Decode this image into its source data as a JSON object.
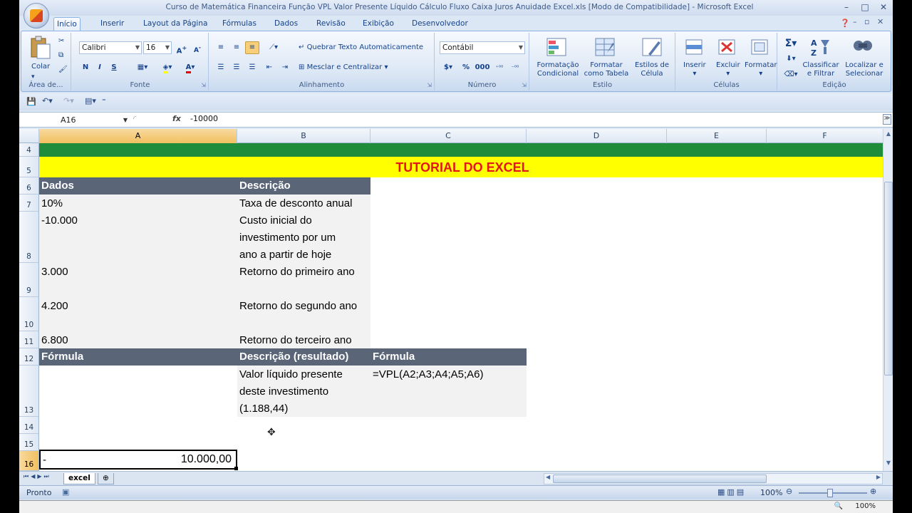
{
  "window": {
    "title": "Curso de Matemática Financeira Função VPL Valor Presente Líquido Cálculo Fluxo Caixa Juros Anuidade Excel.xls  [Modo de Compatibilidade] - Microsoft Excel"
  },
  "tabs": [
    "Início",
    "Inserir",
    "Layout da Página",
    "Fórmulas",
    "Dados",
    "Revisão",
    "Exibição",
    "Desenvolvedor"
  ],
  "ribbon": {
    "clipboard": {
      "paste": "Colar",
      "label": "Área de..."
    },
    "font": {
      "name": "Calibri",
      "size": "16",
      "bold": "N",
      "italic": "I",
      "underline": "S",
      "label": "Fonte"
    },
    "alignment": {
      "wrap": "Quebrar Texto Automaticamente",
      "merge": "Mesclar e Centralizar",
      "label": "Alinhamento"
    },
    "number": {
      "format": "Contábil",
      "currency": "$",
      "percent": "%",
      "thousands": "000",
      "label": "Número"
    },
    "styles": {
      "conditional": "Formatação Condicional",
      "as_table": "Formatar como Tabela",
      "cell_styles": "Estilos de Célula",
      "label": "Estilo"
    },
    "cells": {
      "insert": "Inserir",
      "delete": "Excluir",
      "format": "Formatar",
      "label": "Células"
    },
    "editing": {
      "sigma": "Σ",
      "sort": "Classificar e Filtrar",
      "find": "Localizar e Selecionar",
      "label": "Edição"
    }
  },
  "formula_bar": {
    "cell": "A16",
    "fx": "fx",
    "value": "-10000"
  },
  "columns": [
    "A",
    "B",
    "C",
    "D",
    "E",
    "F"
  ],
  "rows": [
    "4",
    "5",
    "6",
    "7",
    "8",
    "9",
    "10",
    "11",
    "12",
    "13",
    "14",
    "15",
    "16"
  ],
  "cells": {
    "title": "TUTORIAL DO EXCEL",
    "dados": "Dados",
    "descricao": "Descrição",
    "a7": "10%",
    "b7": "Taxa de desconto anual",
    "a8": "-10.000",
    "b8_1": "Custo inicial do",
    "b8_2": "investimento por um",
    "b8_3": "ano a partir de hoje",
    "a9": "3.000",
    "b9": "Retorno do primeiro ano",
    "a10": "4.200",
    "b10": "Retorno do segundo ano",
    "a11": "6.800",
    "b11": "Retorno do terceiro ano",
    "formula_hdr": "Fórmula",
    "desc_result_hdr": "Descrição (resultado)",
    "formula_hdr2": "Fórmula",
    "b13_1": "Valor líquido presente",
    "b13_2": "deste investimento",
    "b13_3": "(1.188,44)",
    "c13": "=VPL(A2;A3;A4;A5;A6)",
    "a16_sign": "-",
    "a16_value": "10.000,00"
  },
  "sheet_tab": "excel",
  "status": {
    "ready": "Pronto",
    "zoom": "100%"
  },
  "taskbar": {
    "zoom": "100%"
  }
}
